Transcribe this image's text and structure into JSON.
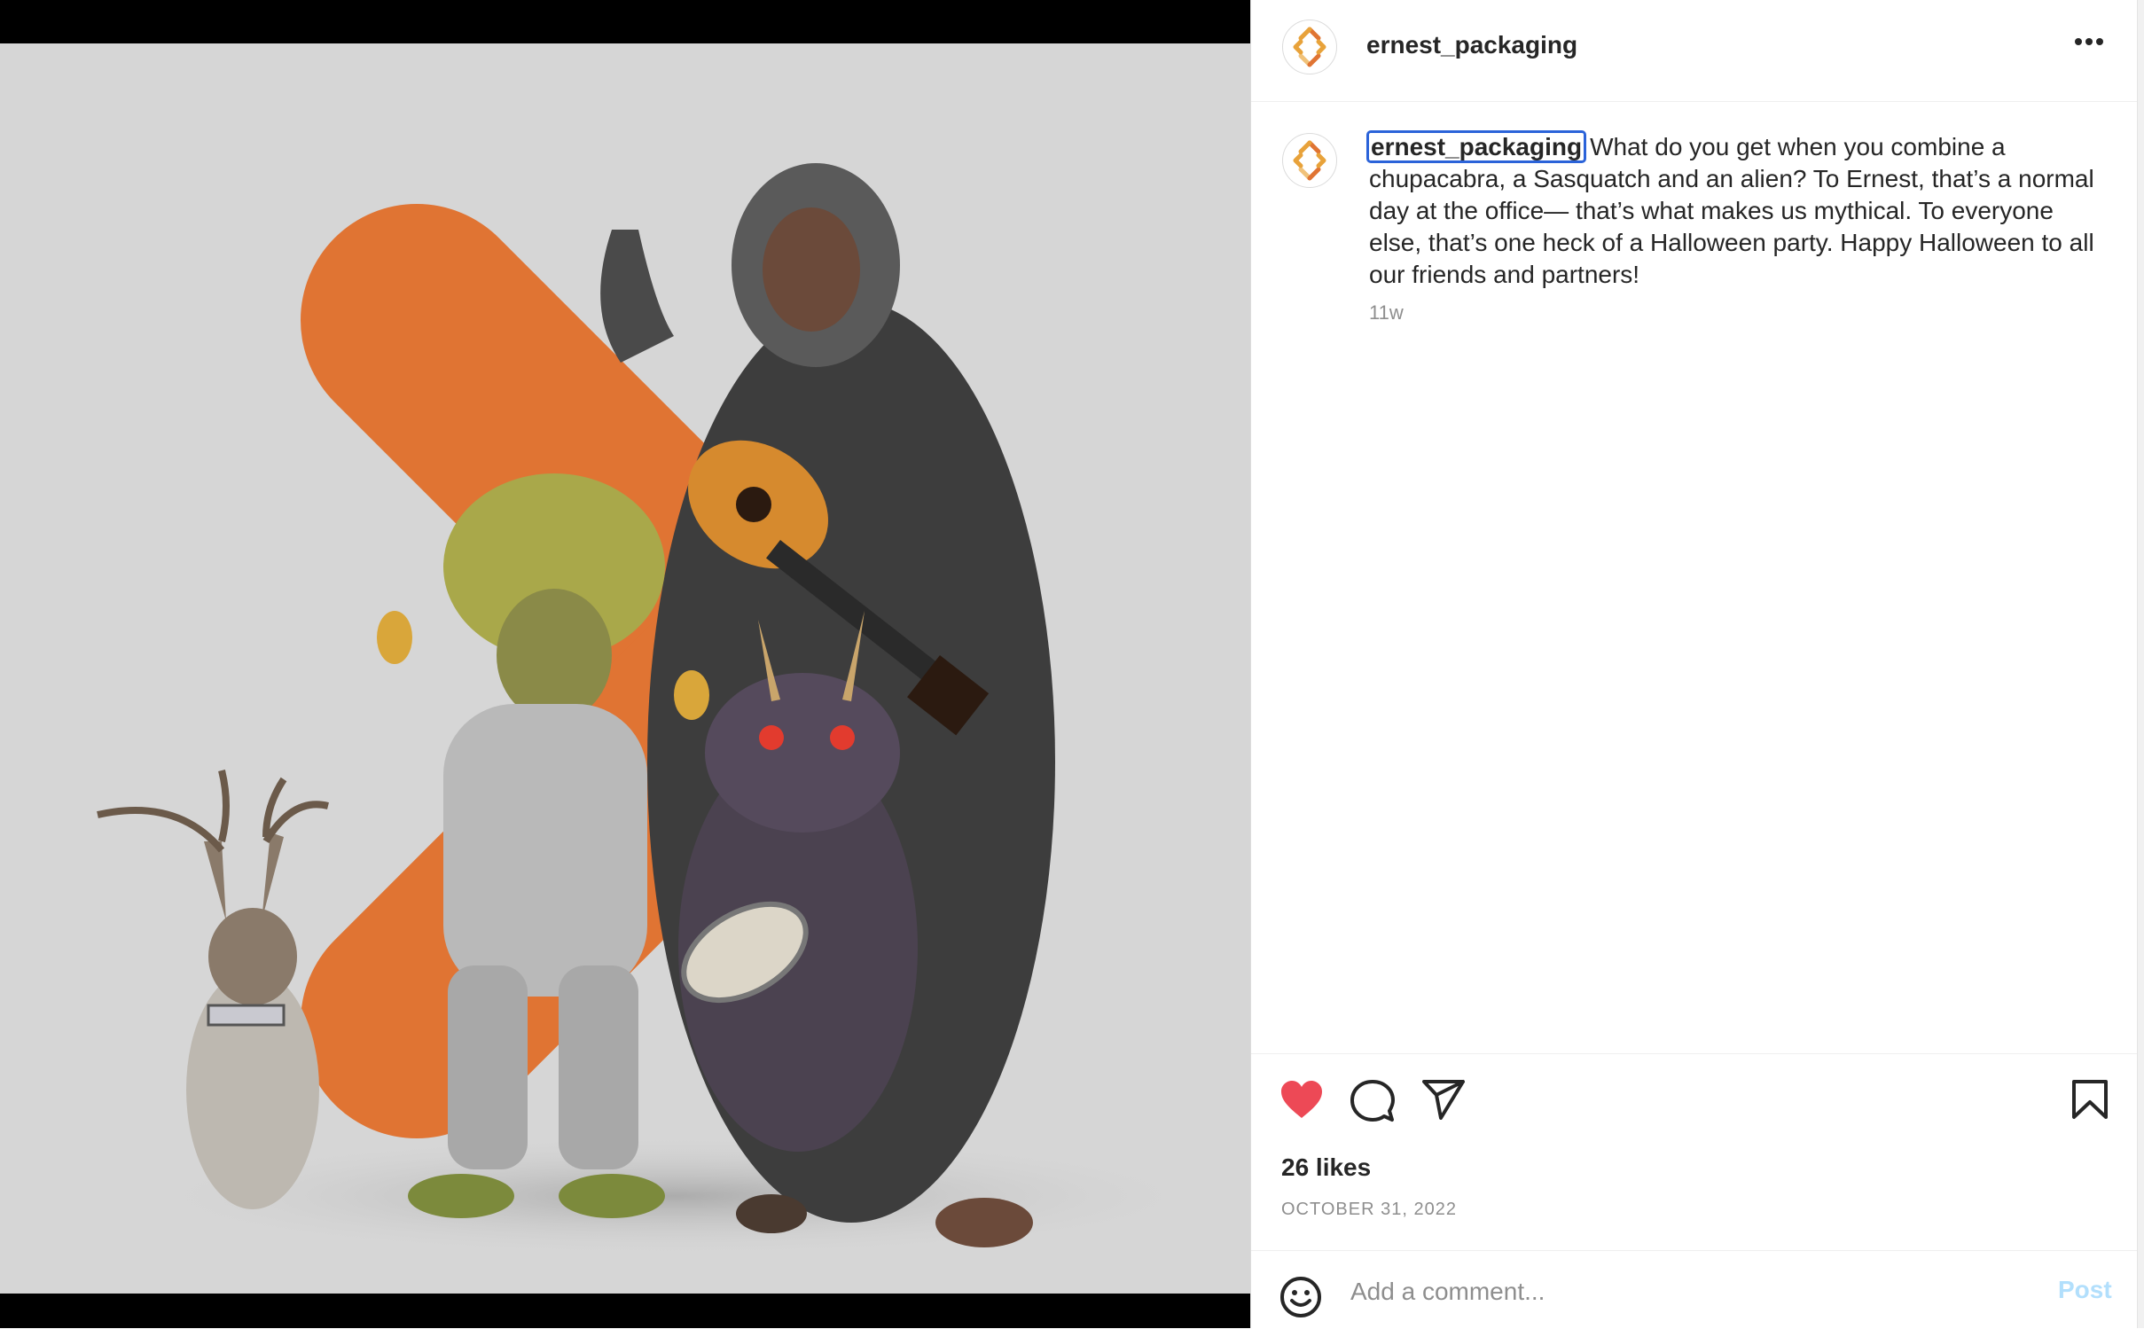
{
  "post": {
    "username": "ernest_packaging",
    "caption_user": "ernest_packaging",
    "caption_text": "What do you get when you combine a chupacabra, a Sasquatch and an alien? To Ernest, that’s a normal day at the office— that’s what makes us mythical. To everyone else, that’s one heck of a Halloween party. Happy Halloween to all our friends and partners!",
    "time_ago": "11w",
    "likes": "26 likes",
    "date": "OCTOBER 31, 2022"
  },
  "comment": {
    "placeholder": "Add a comment...",
    "post_label": "Post"
  },
  "icons": {
    "more": "more-horizontal-icon",
    "like": "heart-filled-icon",
    "comment": "speech-bubble-icon",
    "share": "paper-plane-icon",
    "save": "bookmark-icon",
    "emoji": "smiley-icon"
  },
  "colors": {
    "heart": "#ed4956",
    "brand_orange": "#e07433",
    "post_disabled": "#b2dffc",
    "focus_outline": "#2b63d9"
  }
}
